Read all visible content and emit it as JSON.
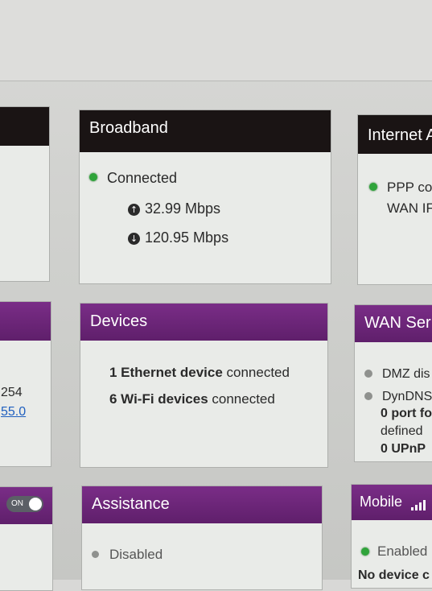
{
  "broadband": {
    "title": "Broadband",
    "status": "Connected",
    "upload": "32.99 Mbps",
    "download": "120.95 Mbps",
    "status_color": "#2fa43a"
  },
  "internet": {
    "title": "Internet A",
    "line1": "PPP co",
    "line2": "WAN IF"
  },
  "devices": {
    "title": "Devices",
    "ethernet_count": "1 Ethernet device",
    "ethernet_suffix": " connected",
    "wifi_count": "6 Wi-Fi devices",
    "wifi_suffix": " connected"
  },
  "wan_services": {
    "title": "WAN Ser",
    "dmz": "DMZ dis",
    "dyndns": "DynDNS",
    "port_bold": "0 port fo",
    "port_rest": "defined",
    "upnp": "0 UPnP"
  },
  "left_fragments": {
    "ip_line": "254",
    "mask_link": "55.0",
    "toggle_label": "ON"
  },
  "assistance": {
    "title": "Assistance",
    "status": "Disabled"
  },
  "mobile": {
    "title": "Mobile",
    "status": "Enabled",
    "device_line": "No device c"
  },
  "icons": {
    "upload": "upload-arrow-icon",
    "download": "download-arrow-icon",
    "signal": "signal-bars-icon"
  }
}
